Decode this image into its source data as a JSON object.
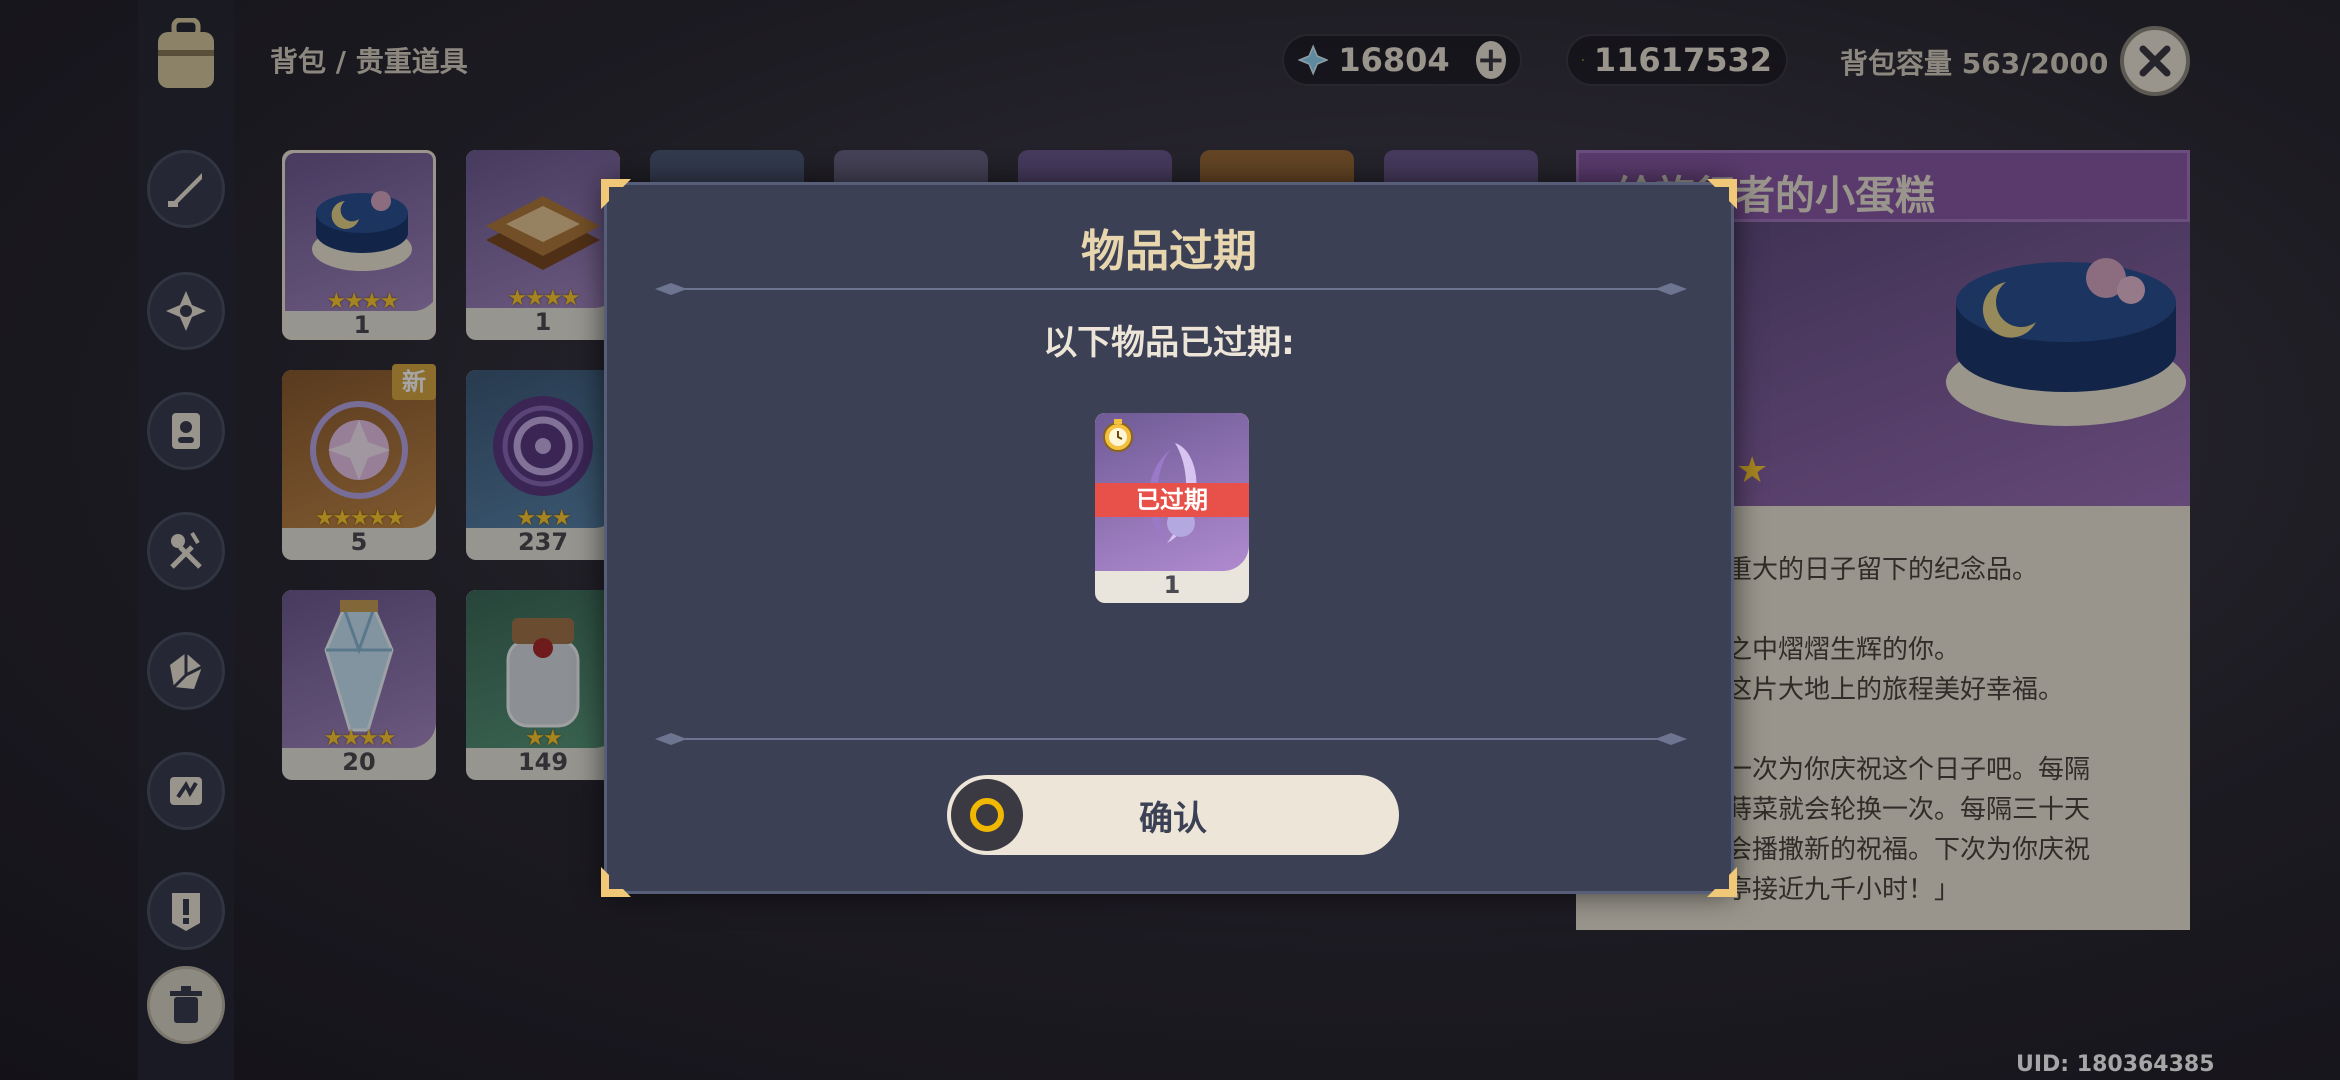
{
  "breadcrumb": "背包 / 贵重道具",
  "currency": {
    "primogems": "16804",
    "mora": "11617532"
  },
  "capacity": "背包容量 563/2000",
  "uid": "UID: 180364385",
  "sidebar": [
    {
      "icon": "weapon-icon"
    },
    {
      "icon": "artifact-icon"
    },
    {
      "icon": "character-card-icon"
    },
    {
      "icon": "food-icon"
    },
    {
      "icon": "material-icon"
    },
    {
      "icon": "gadget-icon"
    },
    {
      "icon": "quest-item-icon"
    },
    {
      "icon": "trash-icon"
    }
  ],
  "inventory": [
    {
      "name": "cake",
      "stars": "★★★★",
      "count": "1"
    },
    {
      "name": "book",
      "stars": "★★★★",
      "count": "1"
    },
    {
      "name": "wish-orb",
      "stars": "★★★★★",
      "count": "5",
      "badge": "新"
    },
    {
      "name": "seal",
      "stars": "★★★",
      "count": "237"
    },
    {
      "name": "crystal",
      "stars": "★★★★",
      "count": "20"
    },
    {
      "name": "jar",
      "stars": "★★",
      "count": "149"
    }
  ],
  "detail": {
    "title": "给旅行者的小蛋糕",
    "lines": [
      "重大的日子留下的纪念品。",
      "之中熠熠生辉的你。",
      "这片大地上的旅程美好幸福。",
      "一次为你庆祝这个日子吧。每隔",
      "蒔菜就会轮换一次。每隔三十天",
      "会播撒新的祝福。下次为你庆祝",
      "亭接近九千小时！」"
    ]
  },
  "modal": {
    "title": "物品过期",
    "subtitle": "以下物品已过期:",
    "item_tag": "已过期",
    "item_count": "1",
    "confirm_label": "确认"
  },
  "colors": {
    "modal_bg": "#3b4055",
    "title_gold": "#e8d6ae",
    "expired_red": "#e8504a",
    "button_bg": "#ece5d8"
  }
}
